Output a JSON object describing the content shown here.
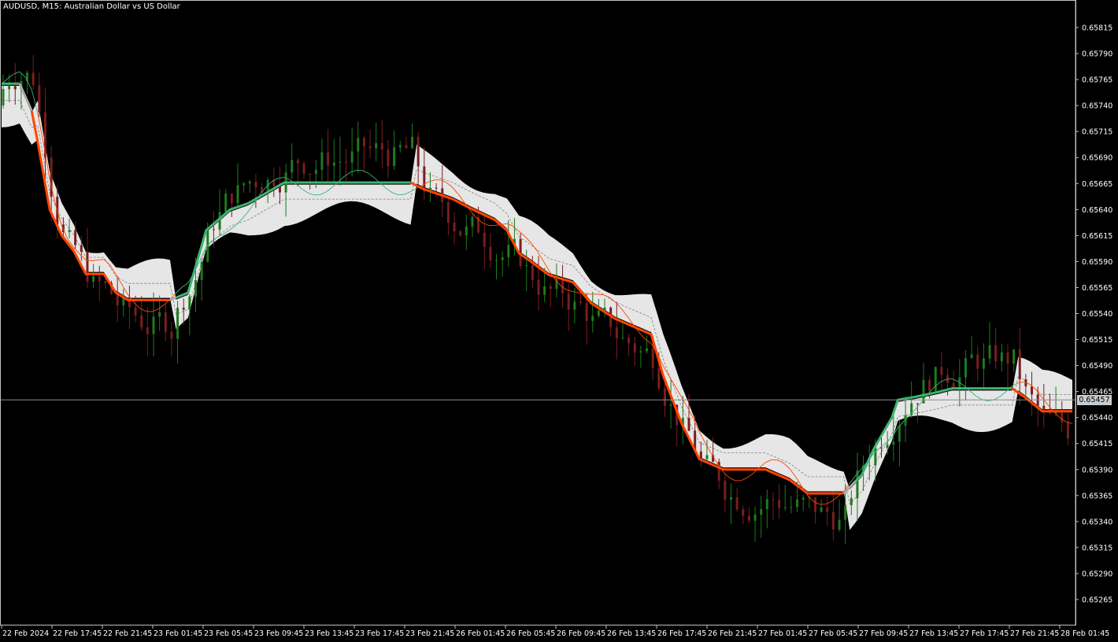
{
  "chart_title": "AUDUSD, M15:  Australian Dollar vs US Dollar",
  "current_price": "0.65457",
  "colors": {
    "background": "#000000",
    "frame": "#c0c0c0",
    "axis_text": "#ffffff",
    "cloud": "#e6e6e6",
    "bull_line": "#3cb371",
    "bear_line": "#ff4500",
    "transition_line": "#a9a9a9",
    "fast_line_bear": "#ff4500",
    "fast_line_bull": "#3cb371",
    "mid_dash": "#808080",
    "candle_bull": "#1e7a1e",
    "candle_bear": "#7a1e1e",
    "candle_in_cloud": "#ff80ff",
    "candle_in_cloud_alt": "#40e0d0",
    "price_line": "#8c8c8c"
  },
  "chart_data": {
    "type": "line",
    "symbol": "AUDUSD",
    "timeframe": "M15",
    "y_ticks": [
      "0.65815",
      "0.65790",
      "0.65765",
      "0.65740",
      "0.65715",
      "0.65690",
      "0.65665",
      "0.65640",
      "0.65615",
      "0.65590",
      "0.65565",
      "0.65540",
      "0.65515",
      "0.65490",
      "0.65465",
      "0.65440",
      "0.65415",
      "0.65390",
      "0.65365",
      "0.65340",
      "0.65315",
      "0.65290",
      "0.65265"
    ],
    "x_ticks": [
      "22 Feb 2024",
      "22 Feb 17:45",
      "22 Feb 21:45",
      "23 Feb 01:45",
      "23 Feb 05:45",
      "23 Feb 09:45",
      "23 Feb 13:45",
      "23 Feb 17:45",
      "23 Feb 21:45",
      "26 Feb 01:45",
      "26 Feb 05:45",
      "26 Feb 09:45",
      "26 Feb 13:45",
      "26 Feb 17:45",
      "26 Feb 21:45",
      "27 Feb 01:45",
      "27 Feb 05:45",
      "27 Feb 09:45",
      "27 Feb 13:45",
      "27 Feb 17:45",
      "27 Feb 21:45",
      "28 Feb 01:45"
    ],
    "ylim": [
      0.6525,
      0.6583
    ],
    "price_line": 0.65457,
    "channel_line": [
      {
        "x": 0,
        "y": 0.65761
      },
      {
        "x": 3,
        "y": 0.65761
      },
      {
        "x": 5,
        "y": 0.65735
      },
      {
        "x": 6,
        "y": 0.65705
      },
      {
        "x": 8,
        "y": 0.6564
      },
      {
        "x": 10,
        "y": 0.65615
      },
      {
        "x": 12,
        "y": 0.656
      },
      {
        "x": 14,
        "y": 0.65578
      },
      {
        "x": 17,
        "y": 0.65578
      },
      {
        "x": 19,
        "y": 0.6556
      },
      {
        "x": 21,
        "y": 0.65553
      },
      {
        "x": 28,
        "y": 0.65553
      },
      {
        "x": 31,
        "y": 0.6556
      },
      {
        "x": 34,
        "y": 0.6562
      },
      {
        "x": 38,
        "y": 0.6564
      },
      {
        "x": 41,
        "y": 0.65646
      },
      {
        "x": 44,
        "y": 0.65656
      },
      {
        "x": 47,
        "y": 0.65666
      },
      {
        "x": 68,
        "y": 0.65666
      },
      {
        "x": 70,
        "y": 0.6566
      },
      {
        "x": 75,
        "y": 0.6565
      },
      {
        "x": 78,
        "y": 0.65641
      },
      {
        "x": 82,
        "y": 0.6563
      },
      {
        "x": 84,
        "y": 0.6562
      },
      {
        "x": 86,
        "y": 0.65598
      },
      {
        "x": 88,
        "y": 0.6559
      },
      {
        "x": 91,
        "y": 0.65577
      },
      {
        "x": 95,
        "y": 0.6557
      },
      {
        "x": 98,
        "y": 0.6555
      },
      {
        "x": 102,
        "y": 0.65535
      },
      {
        "x": 106,
        "y": 0.65525
      },
      {
        "x": 108,
        "y": 0.6552
      },
      {
        "x": 110,
        "y": 0.6548
      },
      {
        "x": 113,
        "y": 0.65435
      },
      {
        "x": 116,
        "y": 0.654
      },
      {
        "x": 120,
        "y": 0.6539
      },
      {
        "x": 127,
        "y": 0.6539
      },
      {
        "x": 131,
        "y": 0.6538
      },
      {
        "x": 134,
        "y": 0.65367
      },
      {
        "x": 140,
        "y": 0.65367
      },
      {
        "x": 143,
        "y": 0.65385
      },
      {
        "x": 145,
        "y": 0.6541
      },
      {
        "x": 148,
        "y": 0.6544
      },
      {
        "x": 149,
        "y": 0.65457
      },
      {
        "x": 152,
        "y": 0.6546
      },
      {
        "x": 156,
        "y": 0.65465
      },
      {
        "x": 158,
        "y": 0.65468
      },
      {
        "x": 168,
        "y": 0.65468
      },
      {
        "x": 170,
        "y": 0.6546
      },
      {
        "x": 173,
        "y": 0.65446
      },
      {
        "x": 178,
        "y": 0.65446
      }
    ],
    "segments": [
      {
        "from": 0,
        "to": 3,
        "trend": "up"
      },
      {
        "from": 3,
        "to": 5,
        "trend": "transition"
      },
      {
        "from": 5,
        "to": 28,
        "trend": "down"
      },
      {
        "from": 28,
        "to": 29,
        "trend": "transition"
      },
      {
        "from": 29,
        "to": 68,
        "trend": "up"
      },
      {
        "from": 68,
        "to": 140,
        "trend": "down"
      },
      {
        "from": 140,
        "to": 142,
        "trend": "transition"
      },
      {
        "from": 142,
        "to": 168,
        "trend": "up"
      },
      {
        "from": 168,
        "to": 178,
        "trend": "down"
      }
    ]
  }
}
